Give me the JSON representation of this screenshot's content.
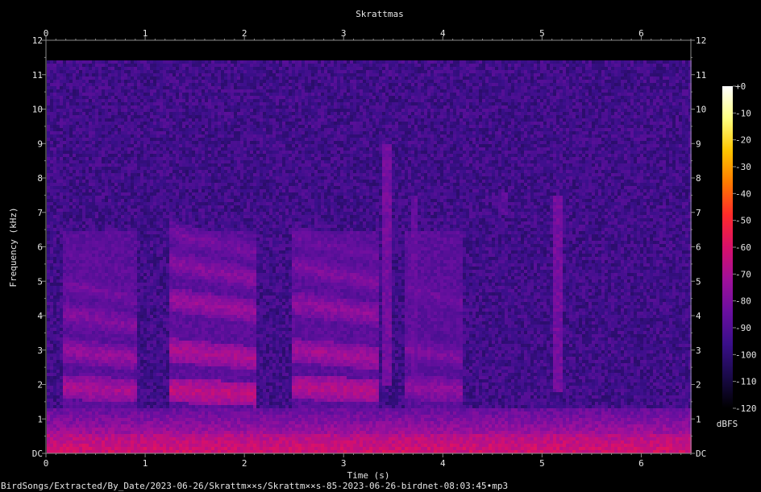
{
  "footer_path": "BirdSongs/Extracted/By_Date/2023-06-26/Skrattm××s/Skrattm××s-85-2023-06-26-birdnet-08:03:45•mp3",
  "chart_data": {
    "type": "heatmap",
    "title": "Skrattmas",
    "xlabel": "Time (s)",
    "ylabel": "Frequency (kHz)",
    "xlim": [
      0,
      6.5
    ],
    "ylim": [
      0,
      12
    ],
    "x_ticks": [
      "0",
      "1",
      "2",
      "3",
      "4",
      "5",
      "6"
    ],
    "y_ticks": [
      "DC",
      "1",
      "2",
      "3",
      "4",
      "5",
      "6",
      "7",
      "8",
      "9",
      "10",
      "11",
      "12"
    ],
    "colorbar": {
      "label": "dBFS",
      "range": [
        -120,
        0
      ],
      "ticks": [
        "+0",
        "-10",
        "-20",
        "-30",
        "-40",
        "-50",
        "-60",
        "-70",
        "-80",
        "-90",
        "-100",
        "-110",
        "-120"
      ],
      "colors": [
        "#000000",
        "#1a0a4a",
        "#3a0f8a",
        "#6a0fa0",
        "#a0109a",
        "#d8106a",
        "#ff2a2a",
        "#ff7a00",
        "#ffc400",
        "#ffff80",
        "#ffffff"
      ]
    },
    "background_level_dbfs": -95,
    "low_frequency_band": {
      "kHz": [
        0,
        0.6
      ],
      "level_dbfs": -60
    },
    "calls": [
      {
        "t": [
          0.15,
          0.9
        ],
        "harmonics_khz": [
          1.9,
          2.9,
          3.9,
          4.7,
          5.5
        ],
        "level_dbfs": -70
      },
      {
        "t": [
          1.22,
          2.1
        ],
        "harmonics_khz": [
          1.8,
          2.9,
          4.3,
          5.3,
          6.1
        ],
        "level_dbfs": -65
      },
      {
        "t": [
          2.45,
          3.35
        ],
        "harmonics_khz": [
          1.9,
          2.9,
          4.2,
          5.2,
          6.0
        ],
        "level_dbfs": -67
      },
      {
        "t": [
          3.6,
          4.2
        ],
        "harmonics_khz": [
          1.9,
          2.9,
          4.6
        ],
        "level_dbfs": -75
      }
    ],
    "streaks": [
      {
        "t": 3.42,
        "khz": [
          2.0,
          9.0
        ],
        "level_dbfs": -82
      },
      {
        "t": 3.7,
        "khz": [
          2.0,
          7.5
        ],
        "level_dbfs": -85
      },
      {
        "t": 5.15,
        "khz": [
          1.8,
          7.5
        ],
        "level_dbfs": -82
      },
      {
        "t": 4.6,
        "khz": [
          7.0,
          7.6
        ],
        "level_dbfs": -88
      }
    ]
  }
}
